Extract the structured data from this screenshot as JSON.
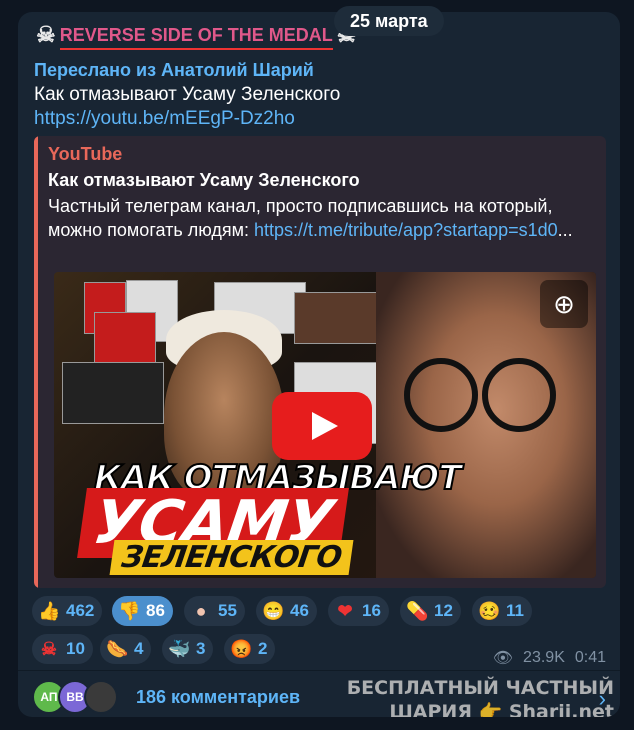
{
  "date": "25 марта",
  "channel": {
    "name": "REVERSE SIDE OF THE MEDAL",
    "icon_left": "skull-icon",
    "icon_right": "skull-icon"
  },
  "forwarded": "Переслано из Анатолий Шарий",
  "message": {
    "text": "Как отмазывают Усаму Зеленского",
    "link": "https://youtu.be/mEEgP-Dz2ho"
  },
  "preview": {
    "site": "YouTube",
    "title": "Как отмазывают Усаму Зеленского",
    "desc_text": "Частный телеграм канал, просто подписавшись на который, можно помогать людям: ",
    "desc_link": "https://t.me/tribute/app?startapp=s1d0",
    "desc_ellipsis": "...",
    "thumb_line1": "КАК ОТМАЗЫВАЮТ",
    "thumb_line2": "УСАМУ",
    "thumb_line3": "ЗЕЛЕНСКОГО",
    "zoom_icon": "zoom-icon"
  },
  "reactions": [
    {
      "emoji": "👍",
      "count": "462",
      "icon": "thumbs-up-icon"
    },
    {
      "emoji": "👎",
      "count": "86",
      "icon": "thumbs-down-icon",
      "active": true
    },
    {
      "emoji": "●",
      "count": "55",
      "icon": "ball-icon"
    },
    {
      "emoji": "😁",
      "count": "46",
      "icon": "grin-icon"
    },
    {
      "emoji": "❤",
      "count": "16",
      "icon": "heart-icon"
    },
    {
      "emoji": "💊",
      "count": "12",
      "icon": "pill-icon"
    },
    {
      "emoji": "🥴",
      "count": "11",
      "icon": "woozy-icon"
    },
    {
      "emoji": "☠",
      "count": "10",
      "icon": "skull-sticker-icon"
    },
    {
      "emoji": "🌭",
      "count": "4",
      "icon": "hotdog-icon"
    },
    {
      "emoji": "🐳",
      "count": "3",
      "icon": "whale-icon"
    },
    {
      "emoji": "😡",
      "count": "2",
      "icon": "angry-icon"
    }
  ],
  "meta": {
    "views": "23.9K",
    "time": "0:41"
  },
  "comments": {
    "avatars": [
      {
        "initials": "АП",
        "color": "#5fb94b"
      },
      {
        "initials": "ВВ",
        "color": "#7b68d6"
      },
      {
        "initials": "",
        "color": "#3a3a3a"
      }
    ],
    "label": "186 комментариев"
  },
  "watermark": {
    "line1": "БЕСПЛАТНЫЙ ЧАСТНЫЙ",
    "line2": "ШАРИЯ 👉 Sharij.net"
  },
  "colors": {
    "accent": "#5eb5f7",
    "background": "#0e1621",
    "bubble": "#182533",
    "youtube": "#e8685a"
  }
}
